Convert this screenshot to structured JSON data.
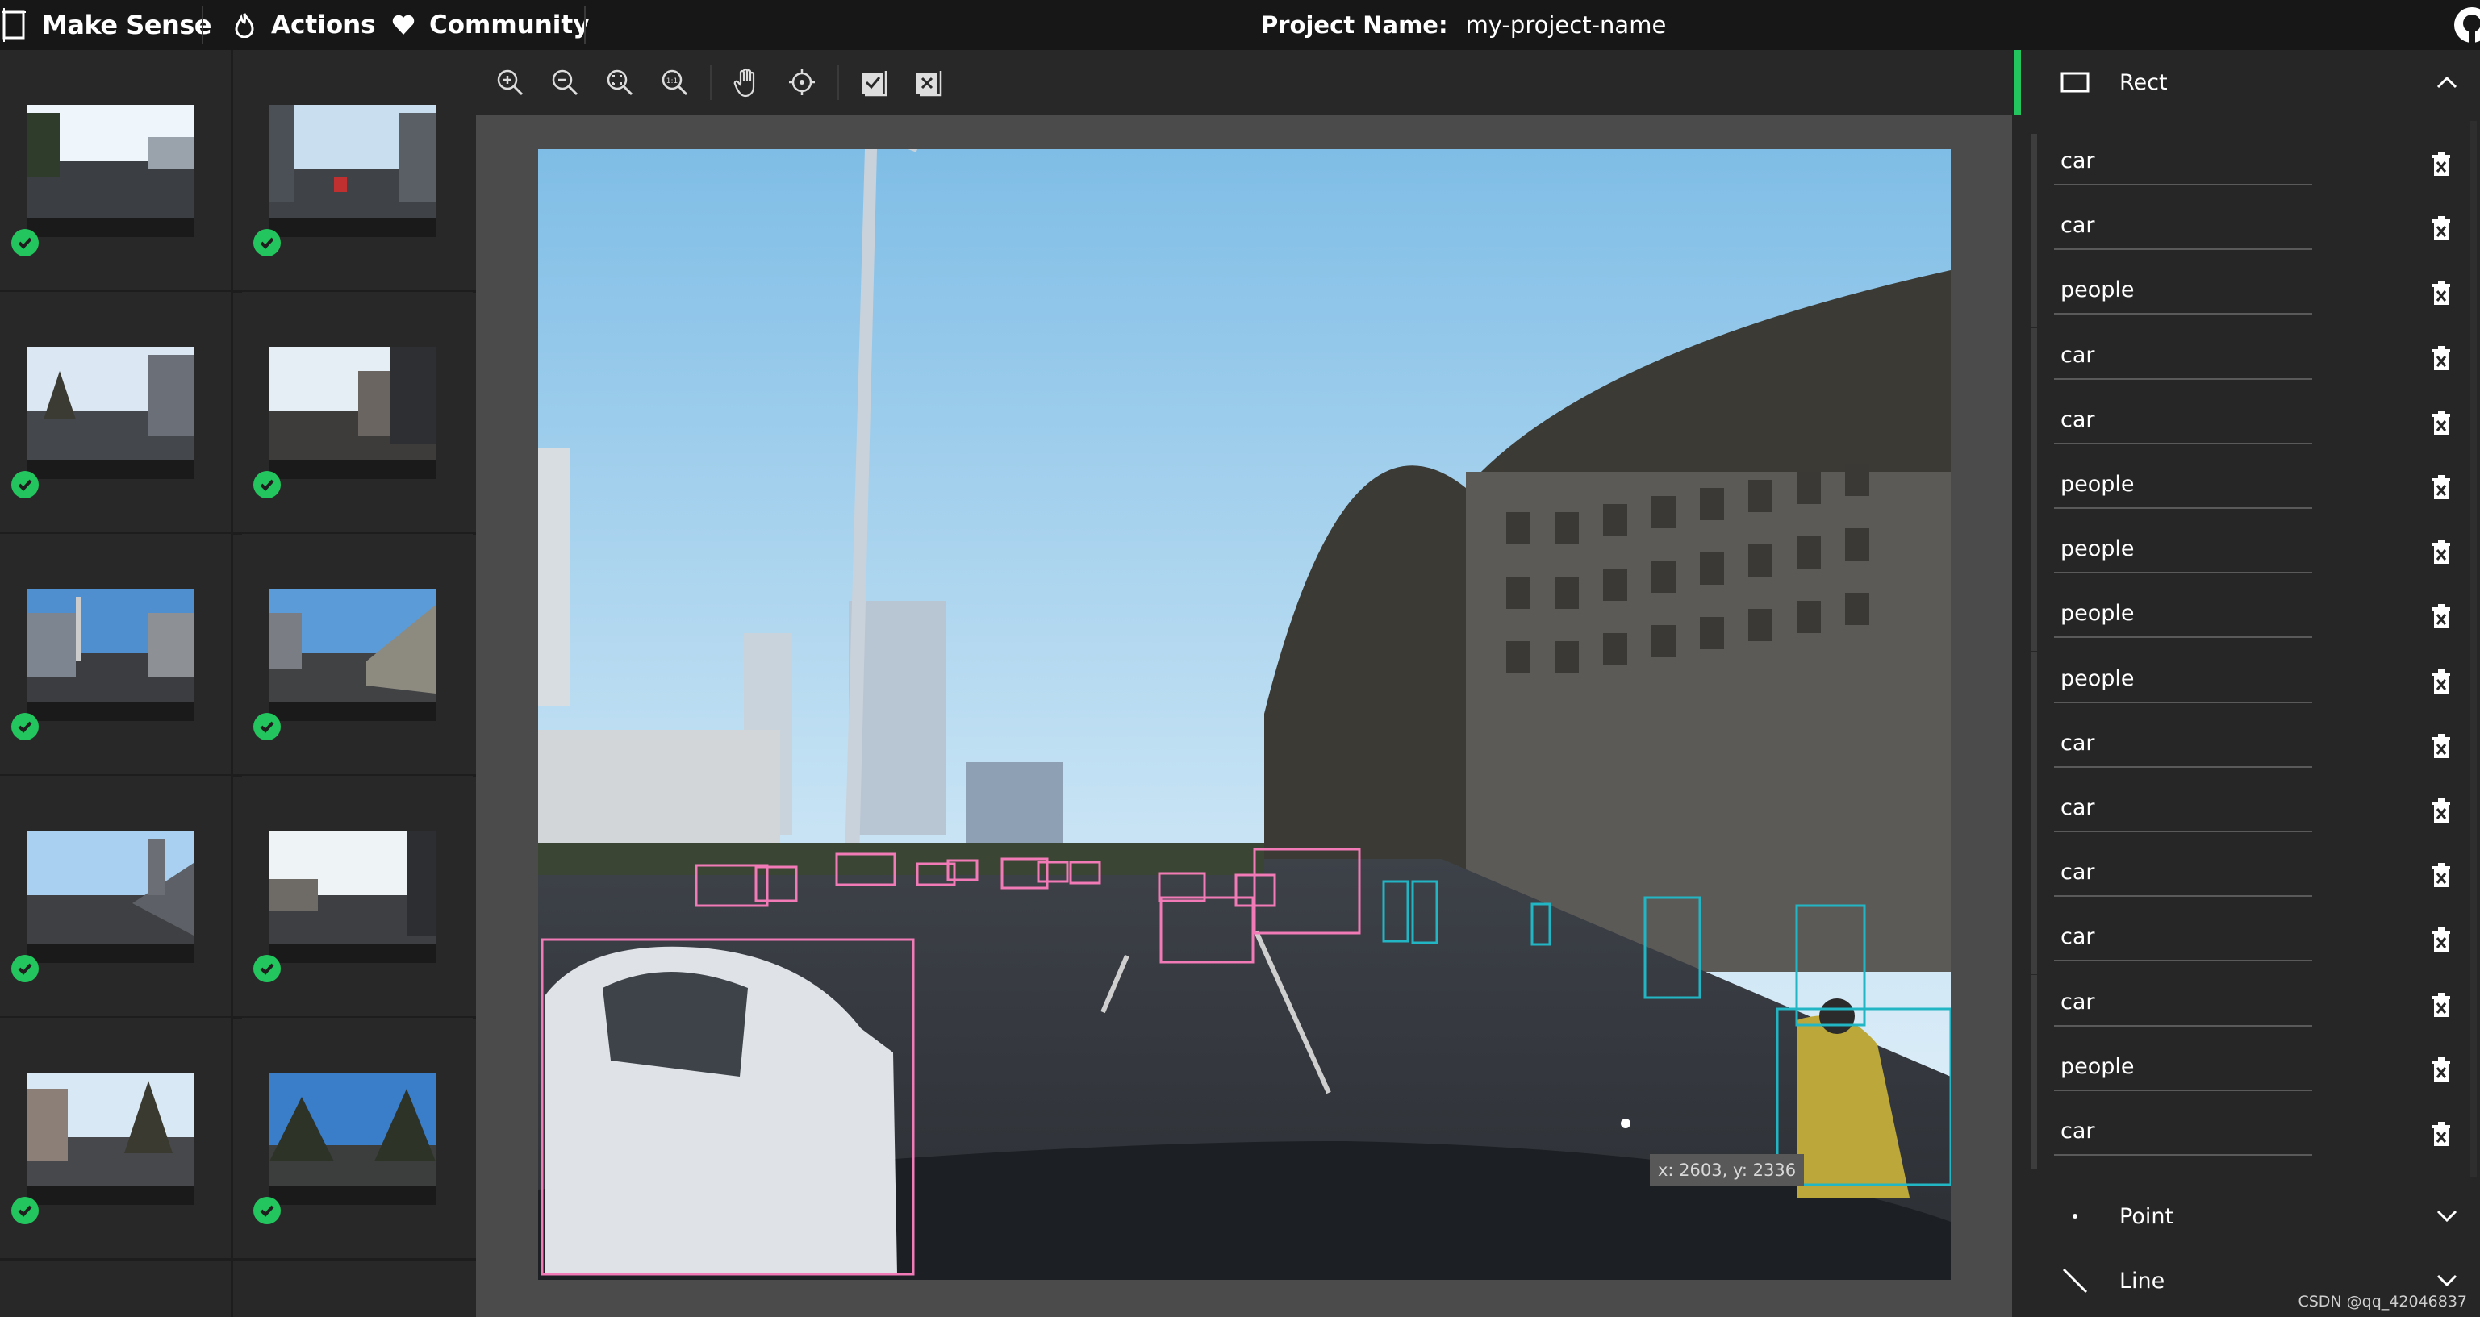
{
  "app": {
    "name": "Make Sense"
  },
  "nav": {
    "actions": "Actions",
    "community": "Community"
  },
  "project": {
    "label": "Project Name:",
    "value": "my-project-name"
  },
  "toolbar": {
    "icons": [
      "zoom-in-icon",
      "zoom-out-icon",
      "zoom-fit-icon",
      "zoom-actual-size-icon",
      "hand-icon",
      "crosshair-icon",
      "accept-labels-icon",
      "reject-labels-icon"
    ]
  },
  "image_list": {
    "count_visible": 10,
    "status": "labeled"
  },
  "canvas": {
    "cursor_readout": "x: 2603, y: 2336"
  },
  "right_panel": {
    "sections": {
      "rect": {
        "label": "Rect",
        "expanded": true
      },
      "point": {
        "label": "Point",
        "expanded": false
      },
      "line": {
        "label": "Line",
        "expanded": false
      }
    },
    "labels": [
      {
        "name": "car"
      },
      {
        "name": "car"
      },
      {
        "name": "people"
      },
      {
        "name": "car"
      },
      {
        "name": "car"
      },
      {
        "name": "people"
      },
      {
        "name": "people"
      },
      {
        "name": "people"
      },
      {
        "name": "people"
      },
      {
        "name": "car"
      },
      {
        "name": "car"
      },
      {
        "name": "car"
      },
      {
        "name": "car"
      },
      {
        "name": "car"
      },
      {
        "name": "people"
      },
      {
        "name": "car"
      }
    ]
  },
  "colors": {
    "accent": "#22c55e",
    "car_box": "#f17ab7",
    "people_box": "#22b5c4"
  },
  "watermark": "CSDN @qq_42046837"
}
